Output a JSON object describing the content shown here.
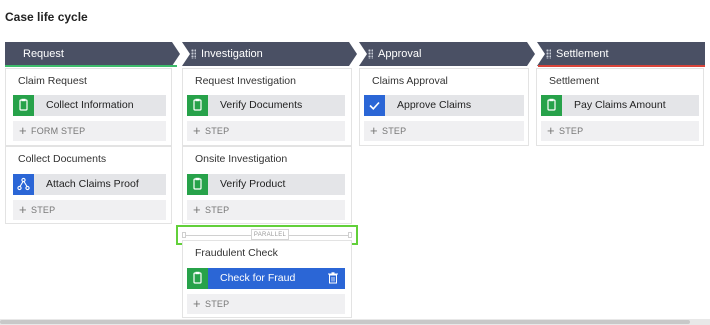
{
  "page_title": "Case life cycle",
  "stages": [
    {
      "label": "Request",
      "accent": "#3dbb6b"
    },
    {
      "label": "Investigation",
      "accent": ""
    },
    {
      "label": "Approval",
      "accent": ""
    },
    {
      "label": "Settlement",
      "accent": "#d9443a"
    }
  ],
  "processes": {
    "claim_request": {
      "title": "Claim Request",
      "step": "Collect Information",
      "add": "FORM STEP"
    },
    "collect_documents": {
      "title": "Collect Documents",
      "step": "Attach Claims Proof",
      "add": "STEP"
    },
    "request_investigation": {
      "title": "Request Investigation",
      "step": "Verify Documents",
      "add": "STEP"
    },
    "onsite_investigation": {
      "title": "Onsite Investigation",
      "step": "Verify Product",
      "add": "STEP"
    },
    "fraudulent_check": {
      "title": "Fraudulent Check",
      "step": "Check for Fraud",
      "add": "STEP"
    },
    "claims_approval": {
      "title": "Claims Approval",
      "step": "Approve Claims",
      "add": "STEP"
    },
    "settlement": {
      "title": "Settlement",
      "step": "Pay Claims Amount",
      "add": "STEP"
    }
  },
  "parallel_label": "PARALLEL",
  "colors": {
    "stage_bg": "#4a5064",
    "step_icon_green": "#27a24a",
    "step_icon_blue": "#2b66d6",
    "active_step": "#2b66d6",
    "selection": "#62d03a"
  }
}
